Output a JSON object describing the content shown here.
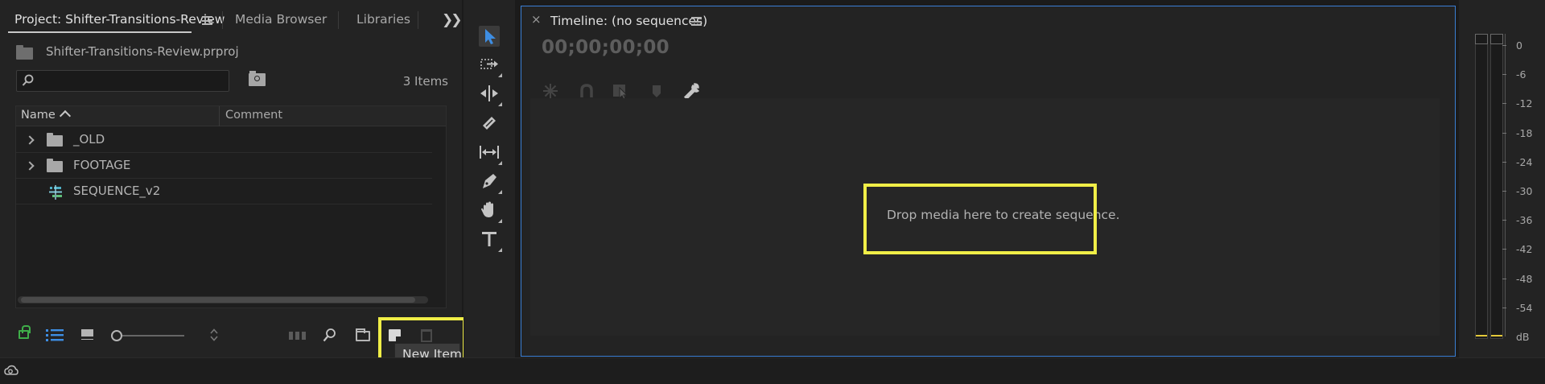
{
  "project_panel": {
    "tabs": [
      {
        "label": "Project: Shifter-Transitions-Review",
        "active": true
      },
      {
        "label": "Media Browser",
        "active": false
      },
      {
        "label": "Libraries",
        "active": false
      }
    ],
    "file_name": "Shifter-Transitions-Review.prproj",
    "search": {
      "value": "",
      "placeholder": ""
    },
    "item_count": "3 Items",
    "columns": {
      "name": "Name",
      "comment": "Comment"
    },
    "items": [
      {
        "label": "_OLD",
        "type": "bin",
        "icon": "folder-icon"
      },
      {
        "label": "FOOTAGE",
        "type": "bin",
        "icon": "folder-icon"
      },
      {
        "label": "SEQUENCE_v2",
        "type": "sequence",
        "icon": "sequence-icon"
      }
    ],
    "tooltip": "New Item"
  },
  "timeline": {
    "title": "Timeline: (no sequences)",
    "close_glyph": "×",
    "timecode": "00;00;00;00",
    "drop_message": "Drop media here to create sequence."
  },
  "audio_meter": {
    "scale": [
      "0",
      "-6",
      "-12",
      "-18",
      "-24",
      "-30",
      "-36",
      "-42",
      "-48",
      "-54",
      "dB"
    ]
  },
  "colors": {
    "panel_bg": "#232323",
    "focus_border": "#3a7fd5",
    "highlight": "#f0ee47",
    "lock_green": "#3fae49",
    "selection_tool_blue": "#3e8ee3",
    "meter_level": "#e3c83a"
  }
}
